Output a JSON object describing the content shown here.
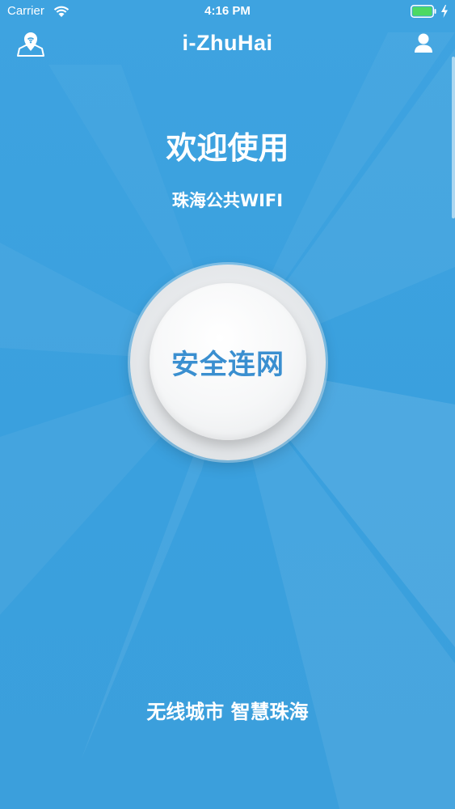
{
  "status_bar": {
    "carrier": "Carrier",
    "time": "4:16 PM",
    "battery_color": "#4cd964"
  },
  "nav": {
    "title": "i-ZhuHai",
    "left_icon": "map-location-icon",
    "right_icon": "user-icon"
  },
  "welcome": {
    "title": "欢迎使用",
    "subtitle": "珠海公共WIFI"
  },
  "connect": {
    "label": "安全连网",
    "label_color": "#3a8fd0"
  },
  "footer": {
    "slogan": "无线城市 智慧珠海"
  },
  "theme": {
    "background": "#3ea3e0",
    "text": "#ffffff"
  }
}
